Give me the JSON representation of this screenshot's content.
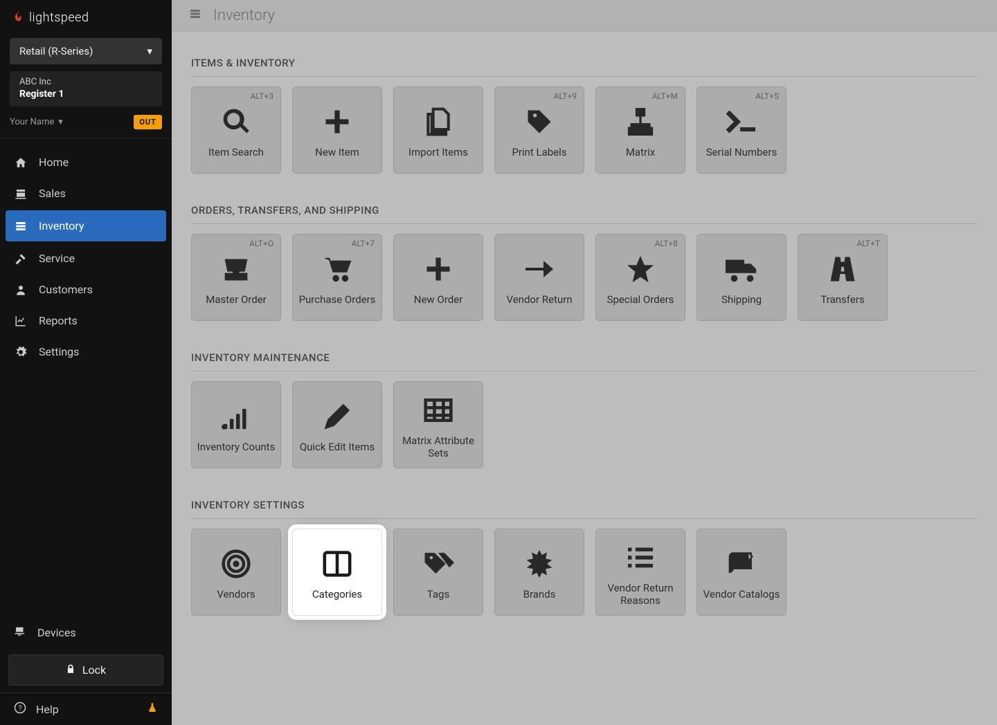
{
  "brand": "lightspeed",
  "product_selector": "Retail (R-Series)",
  "company": {
    "name": "ABC Inc",
    "register": "Register 1"
  },
  "user": {
    "name": "Your Name",
    "badge": "OUT"
  },
  "nav": [
    {
      "label": "Home",
      "icon": "home"
    },
    {
      "label": "Sales",
      "icon": "register"
    },
    {
      "label": "Inventory",
      "icon": "inventory",
      "active": true
    },
    {
      "label": "Service",
      "icon": "hammer"
    },
    {
      "label": "Customers",
      "icon": "user"
    },
    {
      "label": "Reports",
      "icon": "chart"
    },
    {
      "label": "Settings",
      "icon": "gear"
    }
  ],
  "devices_label": "Devices",
  "lock_label": "Lock",
  "help_label": "Help",
  "page_title": "Inventory",
  "sections": [
    {
      "title": "ITEMS & INVENTORY",
      "tiles": [
        {
          "label": "Item Search",
          "shortcut": "ALT+3",
          "icon": "search"
        },
        {
          "label": "New Item",
          "shortcut": "",
          "icon": "plus"
        },
        {
          "label": "Import Items",
          "shortcut": "",
          "icon": "files"
        },
        {
          "label": "Print Labels",
          "shortcut": "ALT+9",
          "icon": "tag"
        },
        {
          "label": "Matrix",
          "shortcut": "ALT+M",
          "icon": "sitemap"
        },
        {
          "label": "Serial Numbers",
          "shortcut": "ALT+S",
          "icon": "terminal"
        }
      ]
    },
    {
      "title": "ORDERS, TRANSFERS, AND SHIPPING",
      "tiles": [
        {
          "label": "Master Order",
          "shortcut": "ALT+O",
          "icon": "inbox"
        },
        {
          "label": "Purchase Orders",
          "shortcut": "ALT+7",
          "icon": "cart"
        },
        {
          "label": "New Order",
          "shortcut": "",
          "icon": "plus"
        },
        {
          "label": "Vendor Return",
          "shortcut": "",
          "icon": "arrow-right"
        },
        {
          "label": "Special Orders",
          "shortcut": "ALT+8",
          "icon": "star"
        },
        {
          "label": "Shipping",
          "shortcut": "",
          "icon": "truck"
        },
        {
          "label": "Transfers",
          "shortcut": "ALT+T",
          "icon": "road"
        }
      ]
    },
    {
      "title": "INVENTORY MAINTENANCE",
      "tiles": [
        {
          "label": "Inventory Counts",
          "shortcut": "",
          "icon": "bars"
        },
        {
          "label": "Quick Edit Items",
          "shortcut": "",
          "icon": "pencil"
        },
        {
          "label": "Matrix Attribute Sets",
          "shortcut": "",
          "icon": "table"
        }
      ]
    },
    {
      "title": "INVENTORY SETTINGS",
      "tiles": [
        {
          "label": "Vendors",
          "shortcut": "",
          "icon": "target"
        },
        {
          "label": "Categories",
          "shortcut": "",
          "icon": "columns",
          "highlight": true
        },
        {
          "label": "Tags",
          "shortcut": "",
          "icon": "tags"
        },
        {
          "label": "Brands",
          "shortcut": "",
          "icon": "burst"
        },
        {
          "label": "Vendor Return Reasons",
          "shortcut": "",
          "icon": "list"
        },
        {
          "label": "Vendor Catalogs",
          "shortcut": "",
          "icon": "book"
        }
      ]
    }
  ]
}
